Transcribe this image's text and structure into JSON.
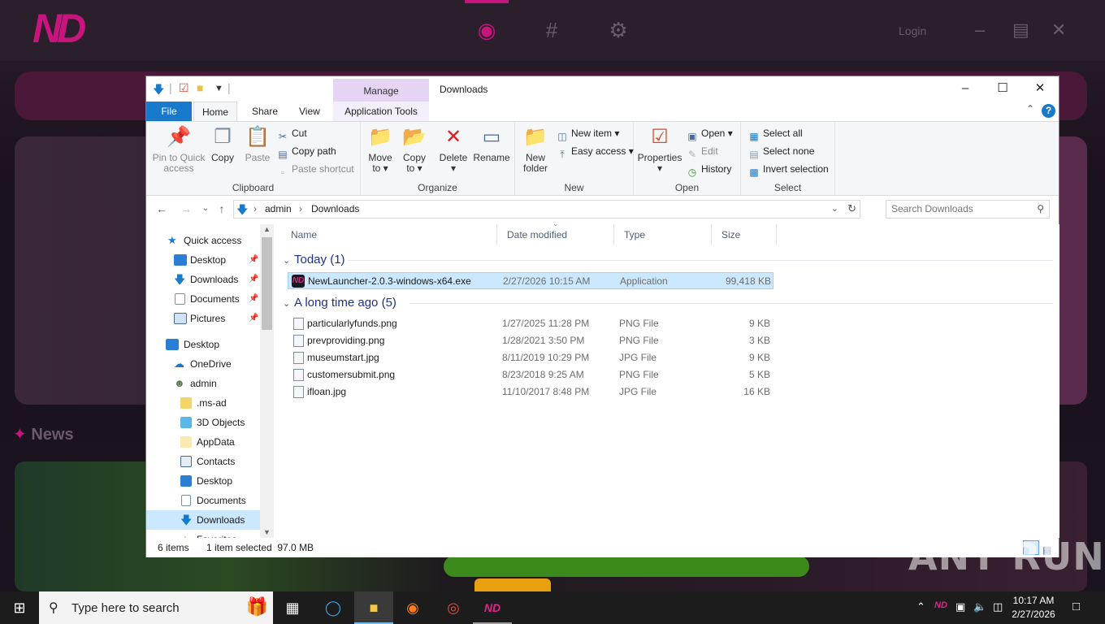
{
  "background_app": {
    "login_label": "Login",
    "news_label": "News",
    "accent_color": "#c8157e"
  },
  "window": {
    "title": "Downloads",
    "manage_label": "Manage",
    "minimize_icon": "minimize-icon",
    "maximize_icon": "maximize-icon",
    "close_icon": "close-icon"
  },
  "ribbon_tabs": {
    "file": "File",
    "home": "Home",
    "share": "Share",
    "view": "View",
    "application_tools": "Application Tools"
  },
  "clipboard": {
    "label": "Clipboard",
    "pin_to_quick_access": "Pin to Quick access",
    "copy": "Copy",
    "paste": "Paste",
    "cut": "Cut",
    "copy_path": "Copy path",
    "paste_shortcut": "Paste shortcut"
  },
  "organize": {
    "label": "Organize",
    "move_to": "Move to",
    "copy_to": "Copy to",
    "delete": "Delete",
    "rename": "Rename"
  },
  "new_group": {
    "label": "New",
    "new_folder": "New folder",
    "new_item": "New item",
    "easy_access": "Easy access"
  },
  "open_group": {
    "label": "Open",
    "properties": "Properties",
    "open": "Open",
    "edit": "Edit",
    "history": "History"
  },
  "select_group": {
    "label": "Select",
    "select_all": "Select all",
    "select_none": "Select none",
    "invert_selection": "Invert selection"
  },
  "address": {
    "crumbs": [
      "admin",
      "Downloads"
    ],
    "search_placeholder": "Search Downloads"
  },
  "nav_pane": {
    "items": [
      {
        "label": "Quick access"
      },
      {
        "label": "Desktop"
      },
      {
        "label": "Downloads"
      },
      {
        "label": "Documents"
      },
      {
        "label": "Pictures"
      },
      {
        "label": "Desktop"
      },
      {
        "label": "OneDrive"
      },
      {
        "label": "admin"
      },
      {
        "label": ".ms-ad"
      },
      {
        "label": "3D Objects"
      },
      {
        "label": "AppData"
      },
      {
        "label": "Contacts"
      },
      {
        "label": "Desktop"
      },
      {
        "label": "Documents"
      },
      {
        "label": "Downloads"
      },
      {
        "label": "Favorites"
      }
    ]
  },
  "columns": {
    "name": "Name",
    "date_modified": "Date modified",
    "type": "Type",
    "size": "Size"
  },
  "groups": {
    "today": "Today (1)",
    "long_ago": "A long time ago (5)"
  },
  "files_today": [
    {
      "name": "NewLauncher-2.0.3-windows-x64.exe",
      "date": "2/27/2026 10:15 AM",
      "type": "Application",
      "size": "99,418 KB"
    }
  ],
  "files_old": [
    {
      "name": "particularlyfunds.png",
      "date": "1/27/2025 11:28 PM",
      "type": "PNG File",
      "size": "9 KB"
    },
    {
      "name": "prevproviding.png",
      "date": "1/28/2021 3:50 PM",
      "type": "PNG File",
      "size": "3 KB"
    },
    {
      "name": "museumstart.jpg",
      "date": "8/11/2019 10:29 PM",
      "type": "JPG File",
      "size": "9 KB"
    },
    {
      "name": "customersubmit.png",
      "date": "8/23/2018 9:25 AM",
      "type": "PNG File",
      "size": "5 KB"
    },
    {
      "name": "ifloan.jpg",
      "date": "11/10/2017 8:48 PM",
      "type": "JPG File",
      "size": "16 KB"
    }
  ],
  "status": {
    "items": "6 items",
    "selected": "1 item selected  97.0 MB"
  },
  "watermark": "ANY RUN",
  "taskbar": {
    "search_placeholder": "Type here to search",
    "time": "10:17 AM",
    "date": "2/27/2026"
  }
}
